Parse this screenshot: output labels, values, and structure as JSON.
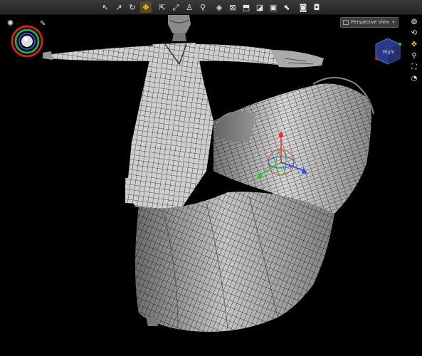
{
  "toolbar": {
    "tools": [
      {
        "name": "select-tool-icon",
        "glyph": "↖"
      },
      {
        "name": "node-select-icon",
        "glyph": "↗"
      },
      {
        "name": "rotate-tool-icon",
        "glyph": "↻"
      },
      {
        "name": "universal-tool-icon",
        "glyph": "✥",
        "active": true
      },
      {
        "name": "translate-tool-icon",
        "glyph": "⇱"
      },
      {
        "name": "scale-tool-icon",
        "glyph": "⤢"
      },
      {
        "name": "joint-editor-icon",
        "glyph": "♙"
      },
      {
        "name": "figure-pose-icon",
        "glyph": "⚲"
      },
      {
        "name": "region-nav-icon",
        "glyph": "◈"
      },
      {
        "name": "geometry-editor-icon",
        "glyph": "⊠"
      },
      {
        "name": "surface-selection-icon",
        "glyph": "⬒"
      },
      {
        "name": "node-weight-brush-icon",
        "glyph": "◪"
      },
      {
        "name": "spot-render-icon",
        "glyph": "▣"
      },
      {
        "name": "pointer-tool-icon",
        "glyph": "⬉"
      },
      {
        "name": "camera-icon",
        "glyph": "◙"
      },
      {
        "name": "render-icon",
        "glyph": "◘"
      }
    ]
  },
  "viewport": {
    "view_label": "Perspective View",
    "cube_label": "Right"
  },
  "colors": {
    "toolbar_bg": "#2e2e2e",
    "viewport_bg": "#000000",
    "gizmo_x": "#2244ff",
    "gizmo_y": "#ff2222",
    "gizmo_z": "#22cc22",
    "active_tool": "#ffcc33"
  }
}
